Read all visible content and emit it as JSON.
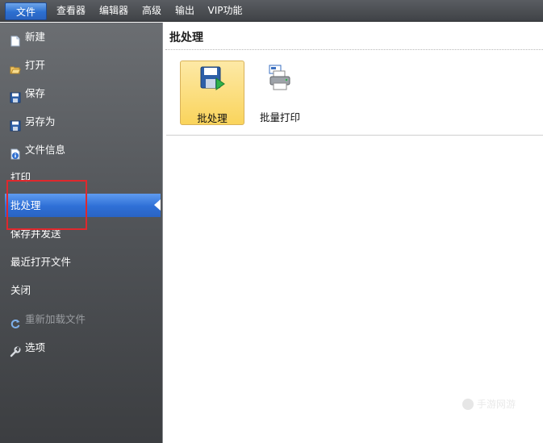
{
  "menubar": {
    "items": [
      {
        "label": "文件",
        "active": true
      },
      {
        "label": "查看器"
      },
      {
        "label": "编辑器"
      },
      {
        "label": "高级"
      },
      {
        "label": "输出"
      },
      {
        "label": "VIP功能"
      }
    ]
  },
  "sidebar": {
    "items": [
      {
        "label": "新建",
        "icon": "new-document-icon"
      },
      {
        "label": "打开",
        "icon": "open-folder-icon"
      },
      {
        "label": "保存",
        "icon": "save-disk-icon"
      },
      {
        "label": "另存为",
        "icon": "save-as-disk-icon"
      },
      {
        "label": "文件信息",
        "icon": "file-info-icon"
      },
      {
        "label": "打印"
      },
      {
        "label": "批处理",
        "selected": true
      },
      {
        "label": "保存并发送"
      },
      {
        "label": "最近打开文件"
      },
      {
        "label": "关闭"
      },
      {
        "label": "重新加载文件",
        "icon": "reload-icon",
        "disabled": true
      },
      {
        "label": "选项",
        "icon": "wrench-icon"
      }
    ]
  },
  "main": {
    "title": "批处理",
    "tiles": [
      {
        "label": "批处理",
        "icon": "batch-save-icon",
        "selected": true
      },
      {
        "label": "批量打印",
        "icon": "batch-print-icon"
      }
    ]
  },
  "watermark": {
    "text": "手游网游"
  },
  "colors": {
    "accent": "#2e6fd6",
    "tile_selected": "#fad45c",
    "highlight_box": "#e0282d",
    "sidebar_bg": "#505357"
  }
}
